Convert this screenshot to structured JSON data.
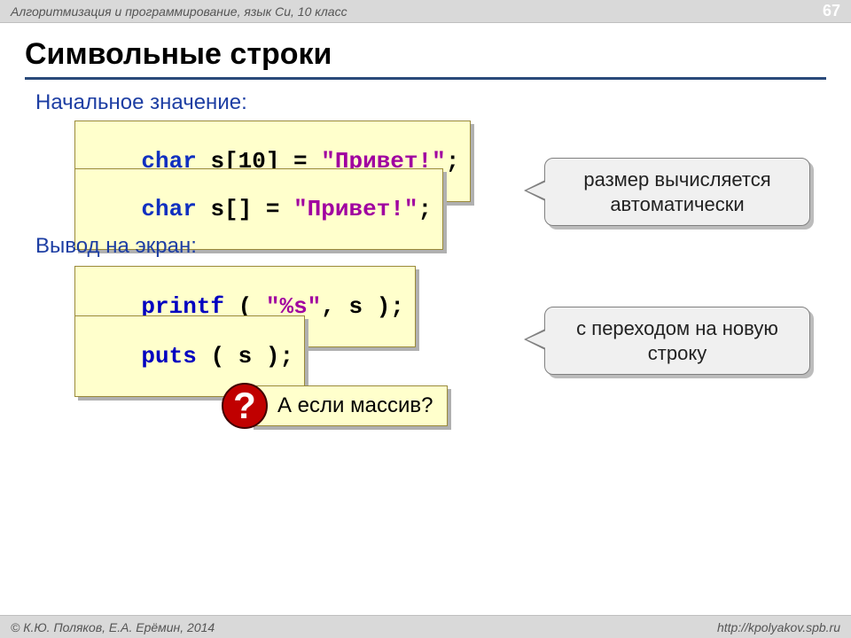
{
  "header": {
    "subject": "Алгоритмизация и программирование, язык Си, 10 класс",
    "page_number": "67"
  },
  "title": "Символьные строки",
  "section1_label": "Начальное значение:",
  "section2_label": "Вывод на экран:",
  "code1": {
    "kw": "char",
    "arr": " s[10] = ",
    "str": "\"Привет!\"",
    "end": ";"
  },
  "code2": {
    "kw": "char",
    "arr": " s[] = ",
    "str": "\"Привет!\"",
    "end": ";"
  },
  "code3": {
    "fn": "printf",
    "args": " ( ",
    "str": "\"%s\"",
    "rest": ", s );"
  },
  "code4": {
    "fn": "puts",
    "args": " ( s );"
  },
  "callout1": "размер вычисляется автоматически",
  "callout2": "с переходом на новую строку",
  "question_mark": "?",
  "question_text": "А если массив?",
  "footer": {
    "authors": "© К.Ю. Поляков, Е.А. Ерёмин, 2014",
    "url": "http://kpolyakov.spb.ru"
  }
}
